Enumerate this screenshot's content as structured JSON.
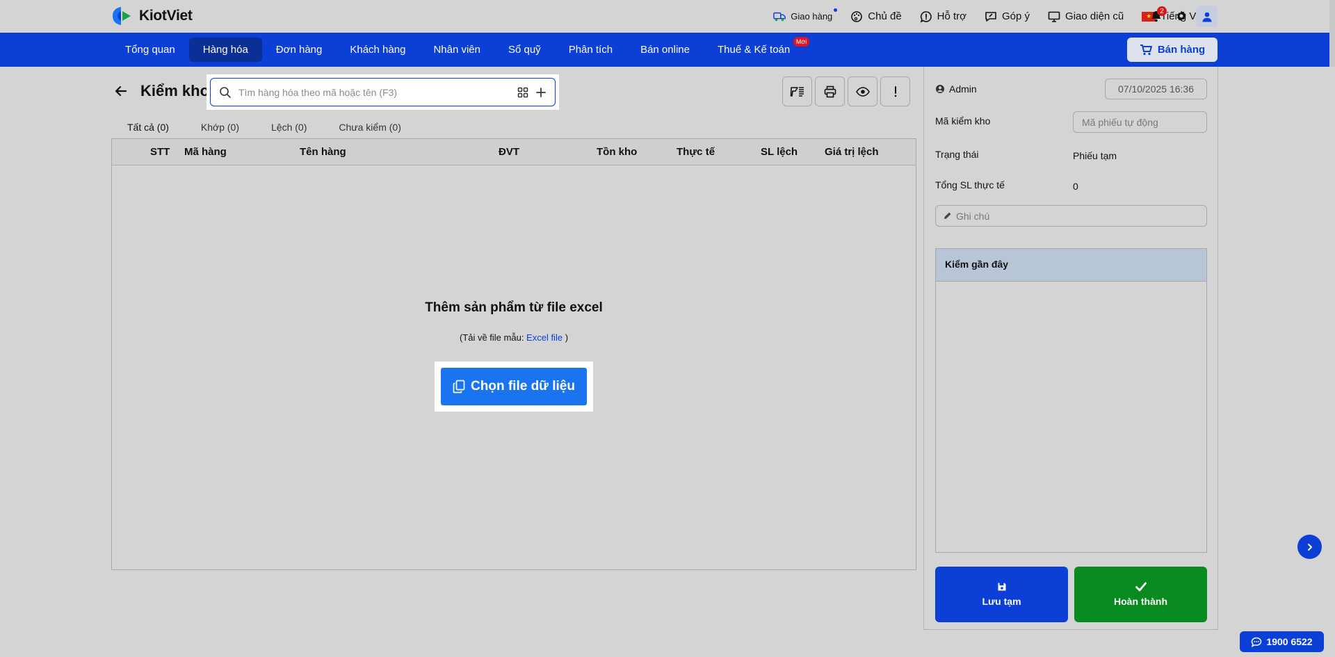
{
  "brand": {
    "name": "KiotViet"
  },
  "topbar": {
    "links": [
      {
        "label": "Giao hàng",
        "icon": "delivery-truck-icon"
      },
      {
        "label": "Chủ đề",
        "icon": "palette-icon"
      },
      {
        "label": "Hỗ trợ",
        "icon": "help-chat-icon"
      },
      {
        "label": "Góp ý",
        "icon": "feedback-icon"
      },
      {
        "label": "Giao diện cũ",
        "icon": "monitor-icon"
      },
      {
        "label": "Tiếng Việt",
        "icon": "vietnam-flag-icon"
      }
    ],
    "notification_count": "2"
  },
  "nav": {
    "items": [
      {
        "label": "Tổng quan"
      },
      {
        "label": "Hàng hóa"
      },
      {
        "label": "Đơn hàng"
      },
      {
        "label": "Khách hàng"
      },
      {
        "label": "Nhân viên"
      },
      {
        "label": "Sổ quỹ"
      },
      {
        "label": "Phân tích"
      },
      {
        "label": "Bán online"
      },
      {
        "label": "Thuế & Kế toán"
      }
    ],
    "active_index": 1,
    "new_badge": "Mới",
    "sell_button": "Bán hàng"
  },
  "page": {
    "title": "Kiểm kho",
    "search_placeholder": "Tìm hàng hóa theo mã hoặc tên (F3)"
  },
  "tabs": [
    {
      "label": "Tất cả (0)"
    },
    {
      "label": "Khớp (0)"
    },
    {
      "label": "Lệch (0)"
    },
    {
      "label": "Chưa kiểm (0)"
    }
  ],
  "table": {
    "columns": [
      "STT",
      "Mã hàng",
      "Tên hàng",
      "ĐVT",
      "Tồn kho",
      "Thực tế",
      "SL lệch",
      "Giá trị lệch"
    ]
  },
  "empty_state": {
    "title": "Thêm sản phẩm từ file excel",
    "sub_prefix": "(Tải về file mẫu: ",
    "link": "Excel file",
    "sub_suffix": " )",
    "button": "Chọn file dữ liệu"
  },
  "panel": {
    "user": "Admin",
    "datetime": "07/10/2025 16:36",
    "code_label": "Mã kiểm kho",
    "code_placeholder": "Mã phiếu tự động",
    "status_label": "Trạng thái",
    "status_value": "Phiếu tạm",
    "total_label": "Tổng SL thực tế",
    "total_value": "0",
    "note_placeholder": "Ghi chú",
    "recent_title": "Kiểm gần đây",
    "save_button": "Lưu tạm",
    "done_button": "Hoàn thành"
  },
  "hotline": "1900 6522",
  "colors": {
    "primary": "#0b3fd6",
    "success": "#078a1e",
    "accent_button": "#1a74ef"
  }
}
